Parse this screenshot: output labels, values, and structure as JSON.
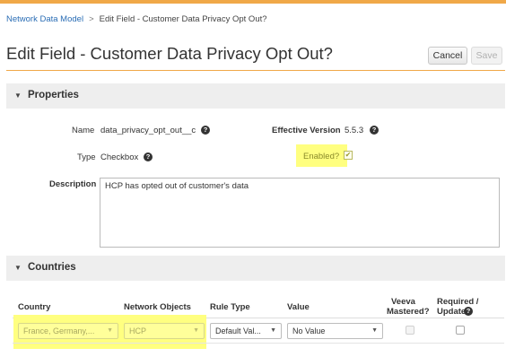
{
  "breadcrumb": {
    "parent": "Network Data Model",
    "separator": ">",
    "current": "Edit Field - Customer Data Privacy Opt Out?"
  },
  "page": {
    "title": "Edit Field - Customer Data Privacy Opt Out?"
  },
  "toolbar": {
    "cancel_label": "Cancel",
    "save_label": "Save"
  },
  "icons": {
    "toggle": "triangle-down",
    "help": "question-circle",
    "caret": "chevron-down",
    "check": "checkmark"
  },
  "colors": {
    "accent": "#f0a848",
    "link": "#2a6db5",
    "highlight": "#ffff80",
    "section_bg": "#eeeeee"
  },
  "properties": {
    "section_title": "Properties",
    "toggle_glyph": "▼",
    "name_label": "Name",
    "name_value": "data_privacy_opt_out__c",
    "type_label": "Type",
    "type_value": "Checkbox",
    "effective_version_label": "Effective Version",
    "effective_version_value": "5.5.3",
    "enabled_label": "Enabled?",
    "enabled_checked": true,
    "enabled_glyph": "✔",
    "description_label": "Description",
    "description_value": "HCP has opted out of customer's data",
    "help_glyph": "?"
  },
  "countries": {
    "section_title": "Countries",
    "toggle_glyph": "▼",
    "columns": {
      "country": "Country",
      "network_objects": "Network Objects",
      "rule_type": "Rule Type",
      "value": "Value",
      "veeva_mastered_1": "Veeva",
      "veeva_mastered_2": "Mastered?",
      "required_1": "Required /",
      "required_2": "Update"
    },
    "row": {
      "country": "France, Germany,...",
      "network_objects": "HCP",
      "rule_type": "Default Val...",
      "value": "No Value",
      "veeva_mastered": false,
      "required_update": false
    },
    "caret_glyph": "▼"
  }
}
